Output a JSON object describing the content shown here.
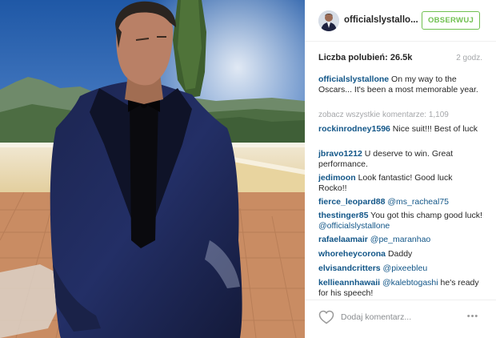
{
  "post": {
    "username": "officialslystallo...",
    "follow_label": "OBSERWUJ",
    "likes": "Liczba polubień: 26.5k",
    "time_ago": "2 godz.",
    "caption_user": "officialslystallone",
    "caption_text": " On my way to the Oscars... It's been a most memorable year.",
    "view_all_text": "zobacz wszystkie komentarze: ",
    "view_all_count": "1,109",
    "add_comment_placeholder": "Dodaj komentarz...",
    "more_label": "•••"
  },
  "comments": [
    {
      "user": "rockinrodney1596",
      "text": " Nice suit!!! Best of luck"
    },
    {
      "user": "jbravo1212",
      "text": " U deserve to win. Great performance."
    },
    {
      "user": "jedimoon",
      "text": " Look fantastic! Good luck Rocko!!"
    },
    {
      "user": "fierce_leopard88",
      "mention": " @ms_racheal75",
      "text": ""
    },
    {
      "user": "thestinger85",
      "text": " You got this champ good luck! ",
      "mention": "@officialslystallone"
    },
    {
      "user": "rafaelaamair",
      "mention": " @pe_maranhao",
      "text": ""
    },
    {
      "user": "whoreheycorona",
      "text": " Daddy"
    },
    {
      "user": "elvisandcritters",
      "mention": " @pixeebleu",
      "text": ""
    },
    {
      "user": "kellieannhawaii",
      "mention": " @kalebtogashi",
      "text": " he's ready for his speech!"
    }
  ],
  "icons": {
    "heart": "heart-icon",
    "more": "more-options-icon",
    "avatar": "profile-avatar"
  },
  "colors": {
    "username": "#125688",
    "follow": "#70c050",
    "muted": "#a5a7aa",
    "text": "#262626"
  }
}
